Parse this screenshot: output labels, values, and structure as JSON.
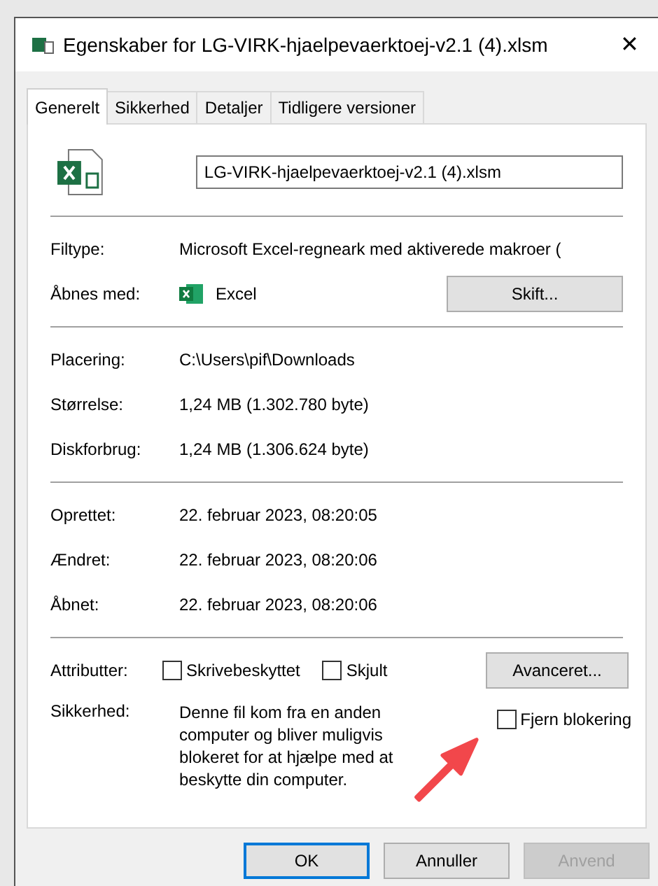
{
  "window": {
    "title": "Egenskaber for LG-VIRK-hjaelpevaerktoej-v2.1 (4).xlsm",
    "close": "✕"
  },
  "tabs": [
    {
      "label": "Generelt",
      "selected": true
    },
    {
      "label": "Sikkerhed",
      "selected": false
    },
    {
      "label": "Detaljer",
      "selected": false
    },
    {
      "label": "Tidligere versioner",
      "selected": false
    }
  ],
  "file_name": "LG-VIRK-hjaelpevaerktoej-v2.1 (4).xlsm",
  "type_section": {
    "file_type_label": "Filtype:",
    "file_type": "Microsoft Excel-regneark med aktiverede makroer (",
    "opens_with_label": "Åbnes med:",
    "opens_with": "Excel",
    "change_button": "Skift..."
  },
  "location_rows": [
    {
      "label": "Placering:",
      "value": "C:\\Users\\pif\\Downloads"
    },
    {
      "label": "Størrelse:",
      "value": "1,24 MB (1.302.780 byte)"
    },
    {
      "label": "Diskforbrug:",
      "value": "1,24 MB (1.306.624 byte)"
    }
  ],
  "date_rows": [
    {
      "label": "Oprettet:",
      "value": "22. februar 2023, 08:20:05"
    },
    {
      "label": "Ændret:",
      "value": "22. februar 2023, 08:20:06"
    },
    {
      "label": "Åbnet:",
      "value": "22. februar 2023, 08:20:06"
    }
  ],
  "attributes": {
    "label": "Attributter:",
    "checkboxes": [
      {
        "label": "Skrivebeskyttet",
        "checked": false
      },
      {
        "label": "Skjult",
        "checked": false
      }
    ],
    "advanced_button": "Avanceret..."
  },
  "security": {
    "label": "Sikkerhed:",
    "text": "Denne fil kom fra en anden computer og bliver muligvis blokeret for at hjælpe med at beskytte din computer.",
    "unblock": {
      "label": "Fjern blokering",
      "checked": false
    }
  },
  "buttons": [
    {
      "label": "OK",
      "default": true,
      "disabled": false
    },
    {
      "label": "Annuller",
      "default": false,
      "disabled": false
    },
    {
      "label": "Anvend",
      "default": false,
      "disabled": true
    }
  ]
}
